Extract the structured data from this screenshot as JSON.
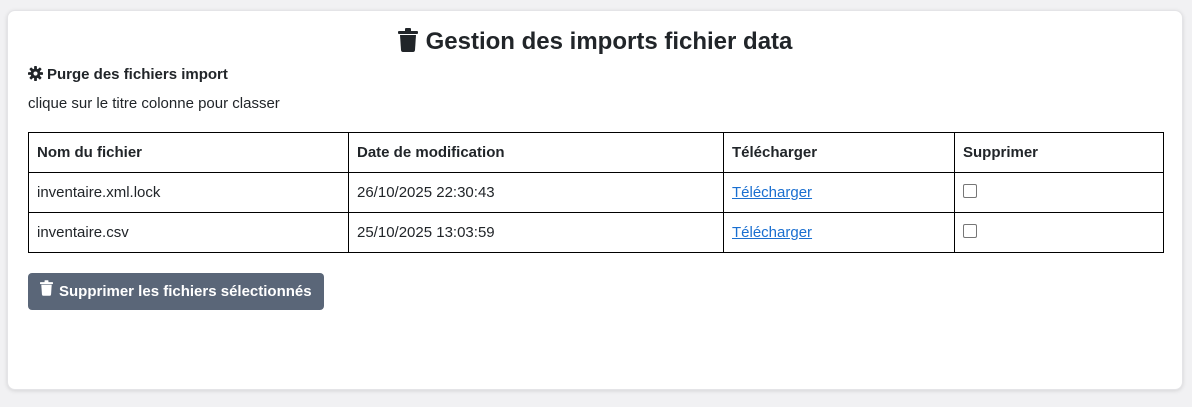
{
  "header": {
    "title": "Gestion des imports fichier data",
    "title_icon": "trash-icon"
  },
  "section": {
    "title": "Purge des fichiers import",
    "icon": "gear-icon",
    "hint": "clique sur le titre colonne pour classer"
  },
  "table": {
    "columns": [
      "Nom du fichier",
      "Date de modification",
      "Télécharger",
      "Supprimer"
    ],
    "rows": [
      {
        "name": "inventaire.xml.lock",
        "date": "26/10/2025 22:30:43",
        "download": "Télécharger",
        "checked": false
      },
      {
        "name": "inventaire.csv",
        "date": "25/10/2025 13:03:59",
        "download": "Télécharger",
        "checked": false
      }
    ]
  },
  "actions": {
    "delete_label": "Supprimer les fichiers sélectionnés",
    "delete_icon": "trash-icon"
  },
  "colors": {
    "button_bg": "#5a6678",
    "link": "#1a6fd0",
    "text": "#212529"
  }
}
